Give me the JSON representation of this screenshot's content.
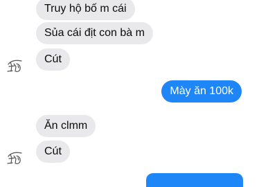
{
  "conversation": {
    "messages": [
      {
        "side": "received",
        "text": "Truy hộ bố m cái"
      },
      {
        "side": "received",
        "text": "Sủa cái địt con bà m"
      },
      {
        "side": "received",
        "text": "Cút",
        "avatar": "sketch-avatar-icon"
      },
      {
        "side": "sent",
        "text": "Mày ăn 100k"
      },
      {
        "side": "received",
        "text": "Ăn clmm"
      },
      {
        "side": "received",
        "text": "Cút",
        "avatar": "sketch-avatar-icon"
      },
      {
        "side": "sent",
        "text": ""
      }
    ]
  },
  "colors": {
    "received_bubble": "#e9e9eb",
    "sent_bubble": "#1f86f7",
    "received_text": "#0a0a0a",
    "sent_text": "#ffffff"
  }
}
